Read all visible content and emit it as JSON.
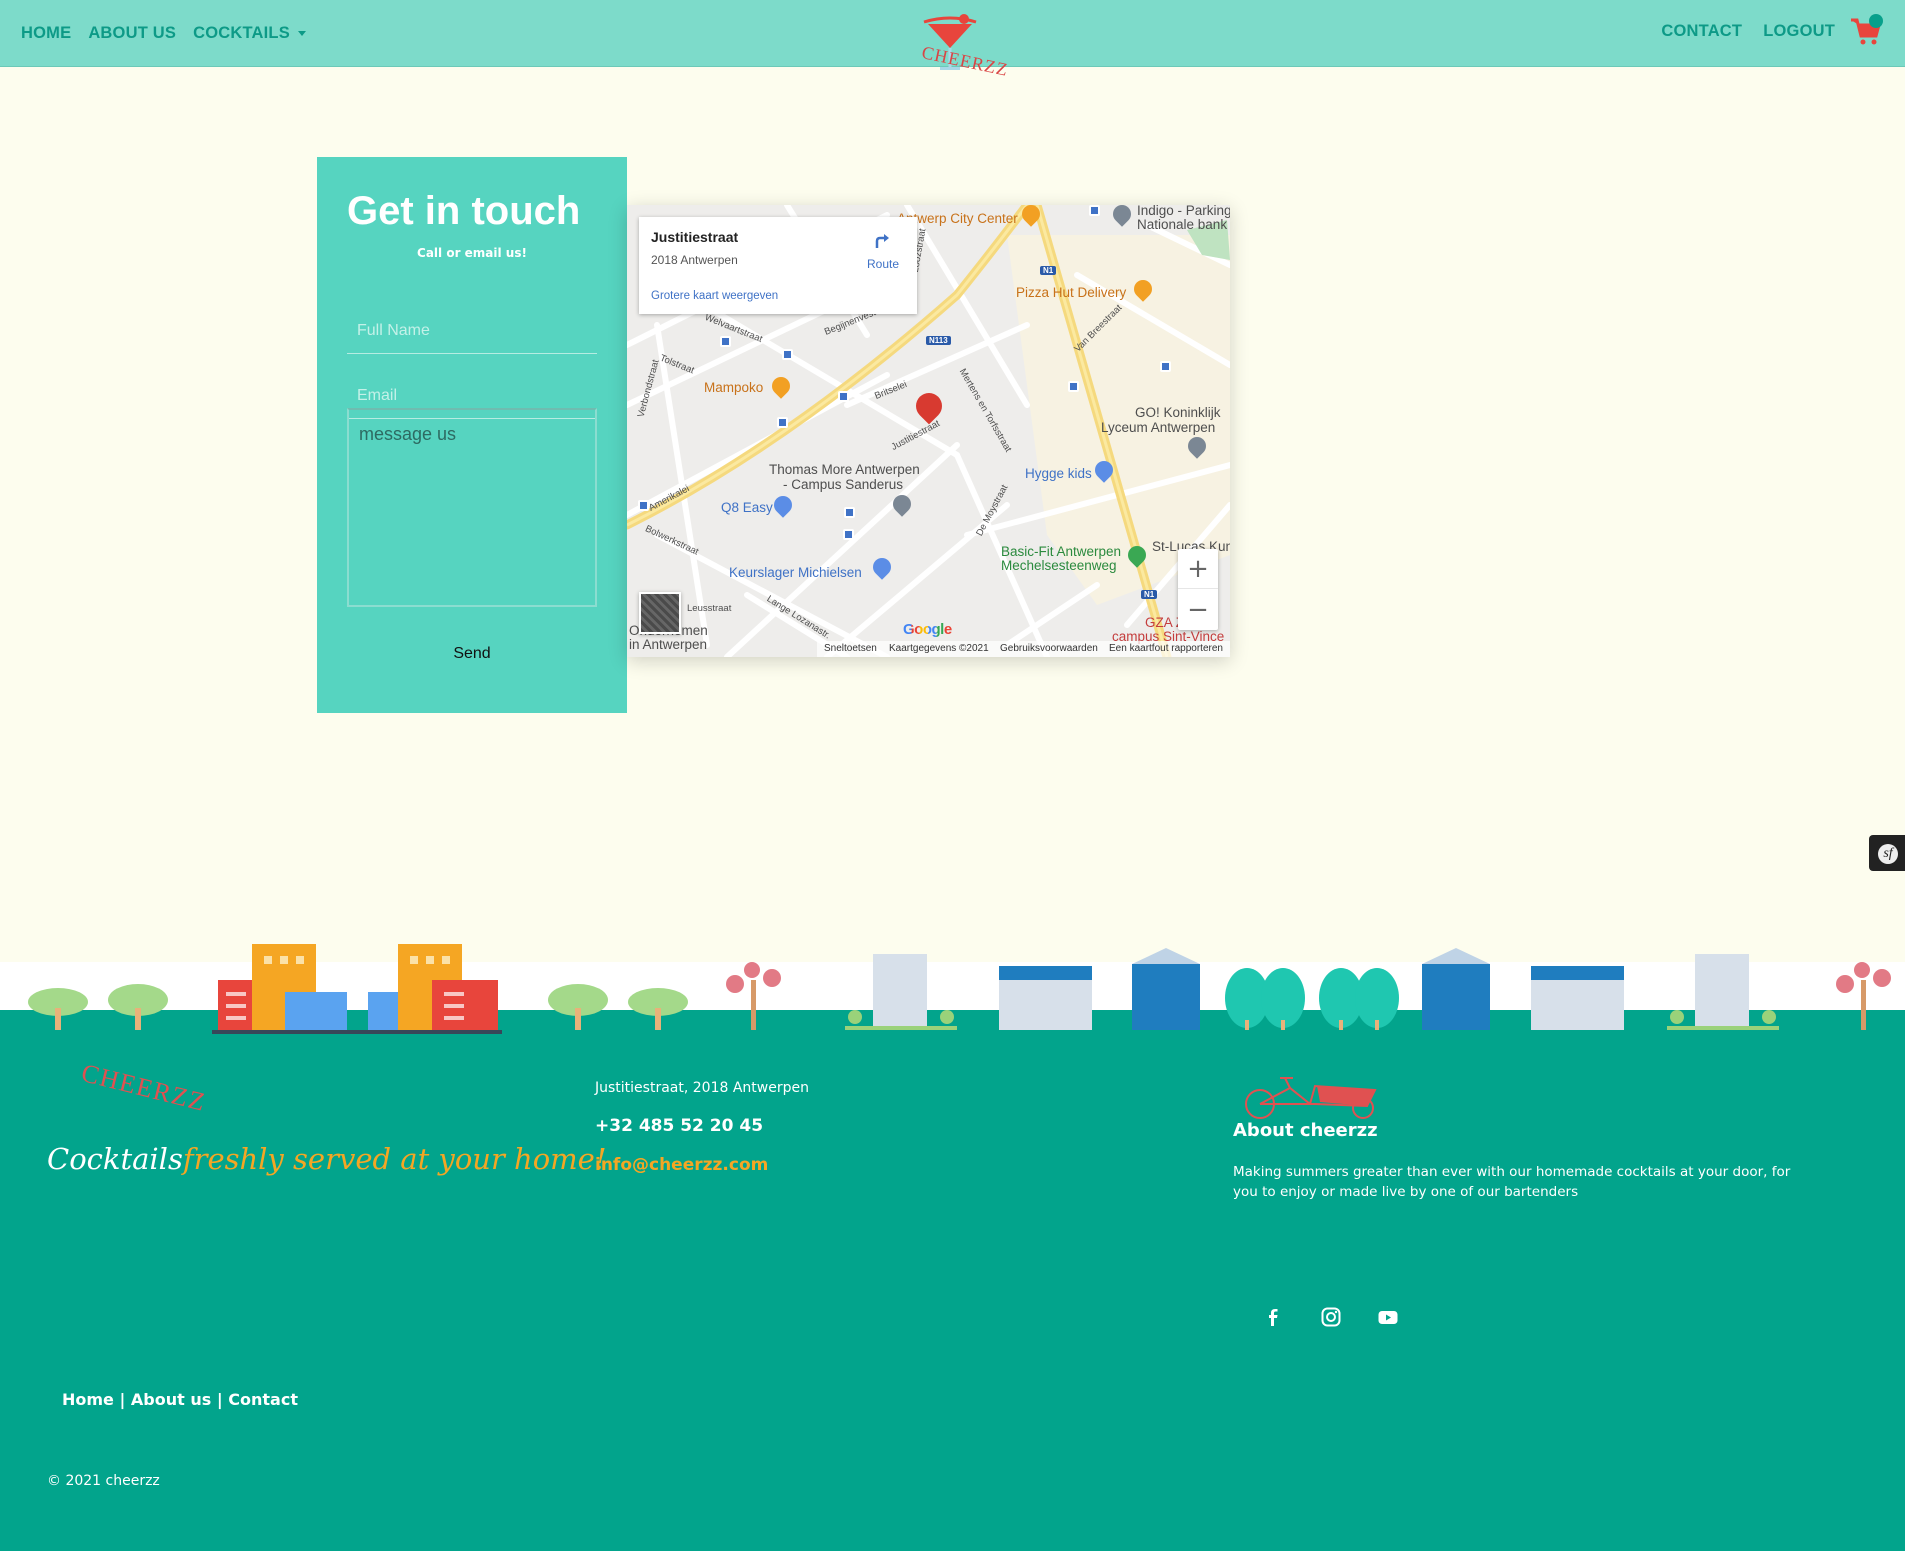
{
  "nav": {
    "home": "HOME",
    "about": "ABOUT US",
    "cocktails": "COCKTAILS",
    "contact": "CONTACT",
    "logout": "LOGOUT",
    "logo_text": "CHEERZZ",
    "cart_icon": "shopping-cart-icon"
  },
  "contact_form": {
    "title": "Get in touch",
    "subtitle": "Call or email us!",
    "name_placeholder": "Full Name",
    "email_placeholder": "Email",
    "message_placeholder": "message us",
    "send_label": "Send"
  },
  "map": {
    "place_title": "Justitiestraat",
    "place_address": "2018 Antwerpen",
    "route_label": "Route",
    "larger_map_link": "Grotere kaart weergeven",
    "labels": {
      "antwerp_city_center": "Antwerp City Center",
      "indigo": "Indigo - Parking",
      "nationale_bank": "Nationale bank",
      "pizza_hut": "Pizza Hut Delivery",
      "mampoko": "Mampoko",
      "go_koninklijk": "GO! Koninklijk",
      "lyceum": "Lyceum Antwerpen",
      "thomas_more": "Thomas More Antwerpen",
      "campus_sanderus": "- Campus Sanderus",
      "hygge_kids": "Hygge kids",
      "q8_easy": "Q8 Easy",
      "basic_fit": "Basic-Fit Antwerpen",
      "mechelse": "Mechelsesteenweg",
      "st_lucas": "St-Lucas Kun",
      "keurslager": "Keurslager Michielsen",
      "gza": "GZA Z",
      "campus_sint_vincentius": "campus Sint-Vince",
      "ondernemen": "Ondernemen",
      "in_antwerpen": "in Antwerpen",
      "n113": "N113",
      "n1": "N1"
    },
    "streets": {
      "welvaartstraat": "Welvaartstraat",
      "begijnenvest": "Begijnenvest",
      "tolstraat": "Tolstraat",
      "verbondstraat": "Verbondstraat",
      "britselei": "Britselei",
      "justitiestraat": "Justitiestraat",
      "mertens": "Mertens en Torfsstraat",
      "amerikalei": "Amerikalei",
      "bolwerkstraat": "Bolwerkstraat",
      "de_moystraat": "De Moystraat",
      "lange_lozanastraat": "Lange Lozanastr.",
      "van_breestraat": "Van Breestraat",
      "leuschstraat": "Leusstraat",
      "loozstraat": "Loozstraat"
    },
    "zoom_in": "+",
    "zoom_out": "−",
    "google": "Google",
    "footer": {
      "shortcuts": "Sneltoetsen",
      "map_data": "Kaartgegevens ©2021",
      "terms": "Gebruiksvoorwaarden",
      "report": "Een kaartfout rapporteren"
    }
  },
  "dev_toolbar_icon": "symfony-icon",
  "footer": {
    "logo_text": "CHEERZZ",
    "tagline_part1": "Cocktails",
    "tagline_part2": "freshly served at your home!",
    "address": "Justitiestraat, 2018 Antwerpen",
    "phone": "+32 485 52 20 45",
    "email": "info@cheerzz.com",
    "about_title": "About cheerzz",
    "about_text": "Making summers greater than ever with our homemade cocktails at your door, for you to enjoy or made live by one of our bartenders",
    "social_icons": [
      "facebook-icon",
      "instagram-icon",
      "youtube-icon"
    ],
    "links": {
      "home": "Home",
      "about": "About us",
      "contact": "Contact",
      "separator": "|"
    },
    "copyright": "© 2021 cheerzz"
  },
  "colors": {
    "navbar": "#7ddbca",
    "nav_text": "#0d9a87",
    "page_bg": "#fdfdee",
    "card": "#56d4c0",
    "footer": "#02a48c",
    "accent_orange": "#f5a623",
    "logo_red": "#d94545"
  }
}
